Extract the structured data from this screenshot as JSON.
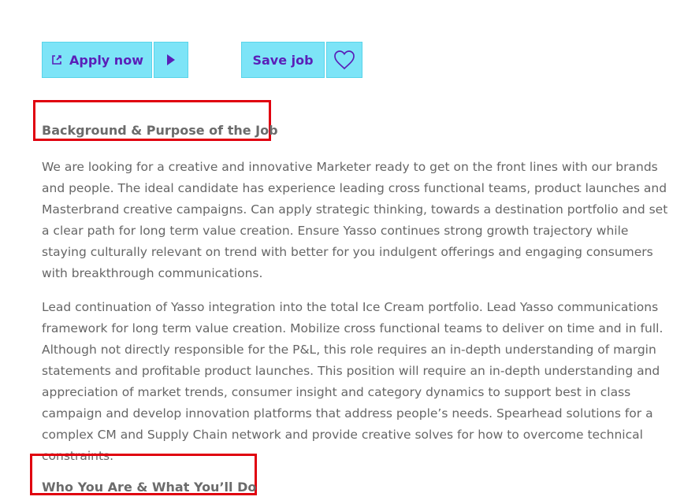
{
  "actions": {
    "apply_now_label": "Apply now",
    "save_job_label": "Save job"
  },
  "content": {
    "background_heading": "Background & Purpose of the Job",
    "background_paragraph": "We are looking for a creative and innovative Marketer ready to get on the front lines with our brands and people. The ideal candidate has experience leading cross functional teams, product launches and Masterbrand creative campaigns. Can apply strategic thinking, towards a destination portfolio and set a clear path for long term value creation. Ensure Yasso continues strong growth trajectory while staying culturally relevant on trend with better for you indulgent offerings and engaging consumers with breakthrough communications.",
    "integration_paragraph": "Lead continuation of Yasso integration into the total Ice Cream portfolio. Lead Yasso communications framework for long term value creation. Mobilize cross functional teams to deliver on time and in full. Although not directly responsible for the P&L, this role requires an in-depth understanding of margin statements and profitable product launches. This position will require an in-depth understanding and appreciation of market trends, consumer insight and category dynamics to support best in class campaign and develop innovation platforms that address people’s needs. Spearhead solutions for a complex CM and Supply Chain network and provide creative solves for how to overcome technical constraints.",
    "who_heading": "Who You Are & What You’ll Do"
  },
  "icons": {
    "external_link": "external-link-icon",
    "play": "play-icon",
    "heart": "heart-icon"
  },
  "colors": {
    "button_background": "#7de4f7",
    "button_text": "#5a1fb8",
    "highlight": "#e0000f",
    "body_text": "#666666"
  }
}
